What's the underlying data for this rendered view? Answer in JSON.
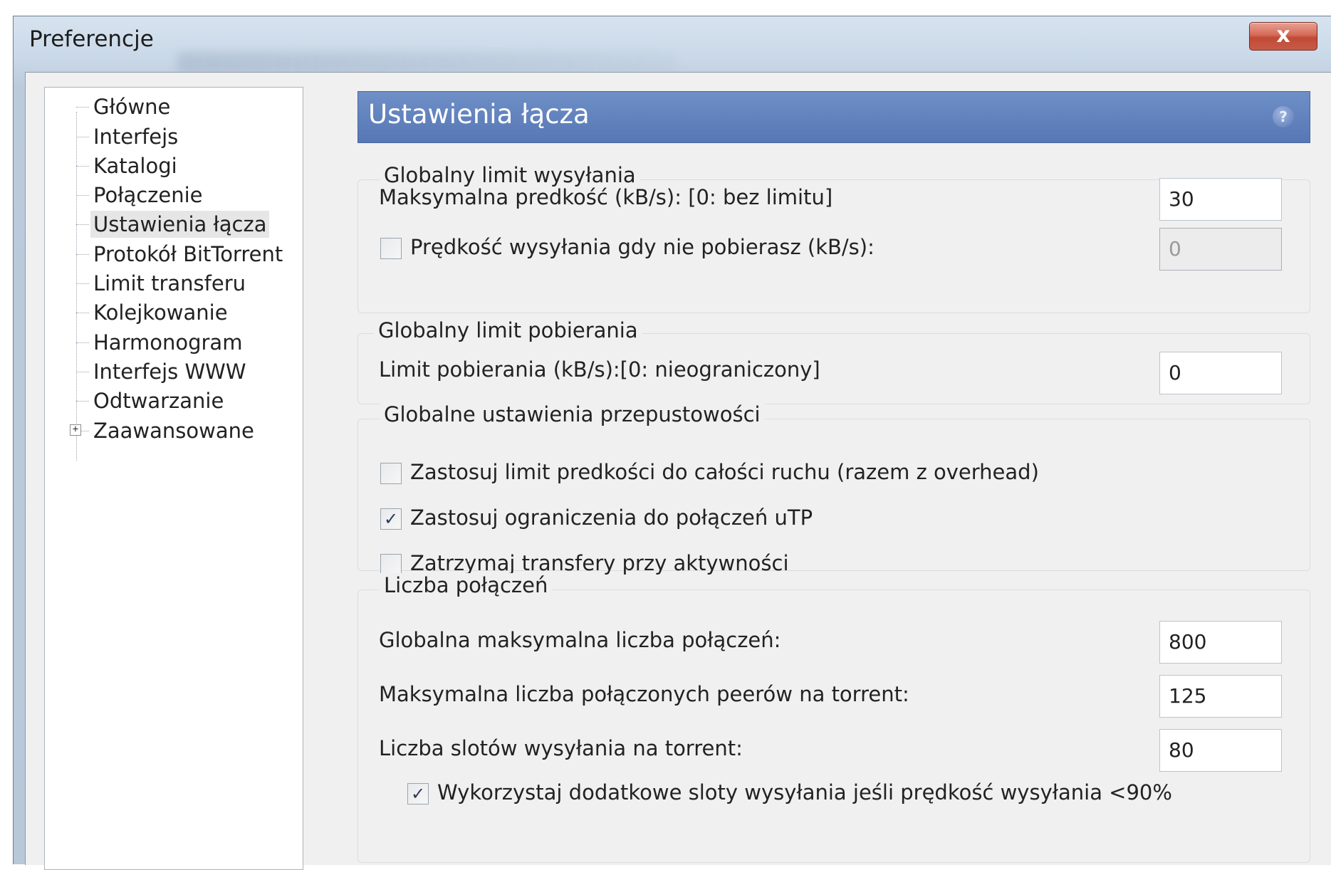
{
  "window": {
    "title": "Preferencje",
    "close_label": "x"
  },
  "sidebar": {
    "items": [
      {
        "label": "Główne"
      },
      {
        "label": "Interfejs"
      },
      {
        "label": "Katalogi"
      },
      {
        "label": "Połączenie"
      },
      {
        "label": "Ustawienia łącza",
        "selected": true
      },
      {
        "label": "Protokół BitTorrent"
      },
      {
        "label": "Limit transferu"
      },
      {
        "label": "Kolejkowanie"
      },
      {
        "label": "Harmonogram"
      },
      {
        "label": "Interfejs WWW"
      },
      {
        "label": "Odtwarzanie"
      },
      {
        "label": "Zaawansowane",
        "expandable": true
      }
    ],
    "expander_glyph": "+"
  },
  "header": {
    "title": "Ustawienia łącza",
    "help_label": "?"
  },
  "upload_group": {
    "title": "Globalny limit wysyłania",
    "max_speed_label": "Maksymalna predkość (kB/s): [0: bez limitu]",
    "max_speed_value": "30",
    "idle_speed_label": "Prędkość wysyłania gdy nie pobierasz (kB/s):",
    "idle_speed_checked": false,
    "idle_speed_value": "0"
  },
  "download_group": {
    "title": "Globalny limit pobierania",
    "limit_label": "Limit pobierania (kB/s):[0: nieograniczony]",
    "limit_value": "0"
  },
  "bandwidth_group": {
    "title": "Globalne ustawienia przepustowości",
    "options": [
      {
        "label": "Zastosuj limit predkości do całości ruchu (razem z overhead)",
        "checked": false
      },
      {
        "label": "Zastosuj ograniczenia do połączeń uTP",
        "checked": true
      },
      {
        "label": "Zatrzymaj transfery przy aktywności",
        "checked": false
      }
    ]
  },
  "connections_group": {
    "title": "Liczba połączeń",
    "global_max_label": "Globalna maksymalna liczba połączeń:",
    "global_max_value": "800",
    "peers_label": "Maksymalna liczba połączonych peerów na torrent:",
    "peers_value": "125",
    "slots_label": "Liczba slotów wysyłania na torrent:",
    "slots_value": "80",
    "extra_slots_label": "Wykorzystaj dodatkowe sloty wysyłania jeśli prędkość wysyłania <90%",
    "extra_slots_checked": true
  },
  "check_glyph": "✓"
}
